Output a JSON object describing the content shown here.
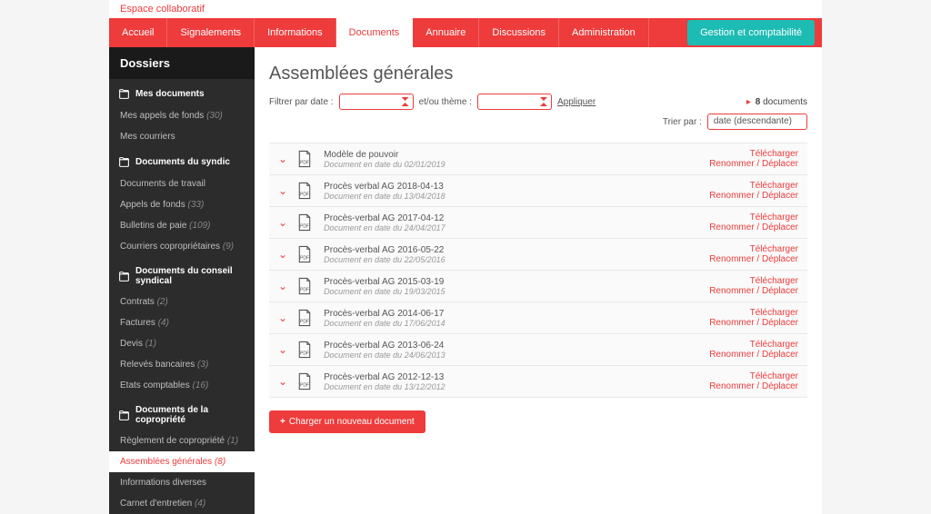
{
  "workspace_label": "Espace collaboratif",
  "nav": {
    "items": [
      {
        "label": "Accueil"
      },
      {
        "label": "Signalements"
      },
      {
        "label": "Informations"
      },
      {
        "label": "Documents",
        "active": true
      },
      {
        "label": "Annuaire"
      },
      {
        "label": "Discussions"
      },
      {
        "label": "Administration"
      }
    ],
    "teal_button": "Gestion et comptabilité"
  },
  "sidebar": {
    "title": "Dossiers",
    "sections": [
      {
        "label": "Mes documents",
        "items": [
          {
            "label": "Mes appels de fonds",
            "count": "(30)"
          },
          {
            "label": "Mes courriers"
          }
        ]
      },
      {
        "label": "Documents du syndic",
        "items": [
          {
            "label": "Documents de travail"
          },
          {
            "label": "Appels de fonds",
            "count": "(33)"
          },
          {
            "label": "Bulletins de paie",
            "count": "(109)"
          },
          {
            "label": "Courriers copropriétaires",
            "count": "(9)"
          }
        ]
      },
      {
        "label": "Documents du conseil syndical",
        "items": [
          {
            "label": "Contrats",
            "count": "(2)"
          },
          {
            "label": "Factures",
            "count": "(4)"
          },
          {
            "label": "Devis",
            "count": "(1)"
          },
          {
            "label": "Relevés bancaires",
            "count": "(3)"
          },
          {
            "label": "Etats comptables",
            "count": "(16)"
          }
        ]
      },
      {
        "label": "Documents de la copropriété",
        "items": [
          {
            "label": "Règlement de copropriété",
            "count": "(1)"
          },
          {
            "label": "Assemblées générales",
            "count": "(8)",
            "active": true
          },
          {
            "label": "Informations diverses"
          },
          {
            "label": "Carnet d'entretien",
            "count": "(4)"
          }
        ]
      }
    ]
  },
  "main": {
    "title": "Assemblées générales",
    "filter_label_date": "Filtrer par date :",
    "filter_label_theme": "et/ou thème :",
    "apply_label": "Appliquer",
    "doc_count_prefix": "▸",
    "doc_count_num": "8",
    "doc_count_word": "documents",
    "sort_label": "Trier par :",
    "sort_value": "date (descendante)",
    "download_label": "Télécharger",
    "rename_label": "Renommer / Déplacer",
    "upload_label": "Charger un nouveau document",
    "docs": [
      {
        "title": "Modèle de pouvoir",
        "date": "Document en date du 02/01/2019"
      },
      {
        "title": "Procès verbal AG 2018-04-13",
        "date": "Document en date du 13/04/2018"
      },
      {
        "title": "Procès-verbal AG 2017-04-12",
        "date": "Document en date du 24/04/2017"
      },
      {
        "title": "Procès-verbal AG 2016-05-22",
        "date": "Document en date du 22/05/2016"
      },
      {
        "title": "Procès-verbal AG 2015-03-19",
        "date": "Document en date du 19/03/2015"
      },
      {
        "title": "Procès-verbal AG 2014-06-17",
        "date": "Document en date du 17/06/2014"
      },
      {
        "title": "Procès-verbal AG 2013-06-24",
        "date": "Document en date du 24/06/2013"
      },
      {
        "title": "Procès-verbal AG 2012-12-13",
        "date": "Document en date du 13/12/2012"
      }
    ]
  }
}
